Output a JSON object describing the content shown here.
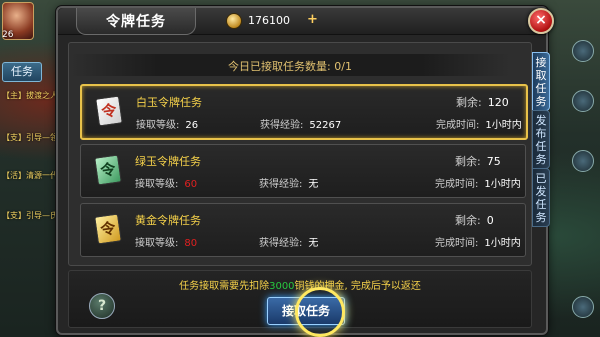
{
  "hud": {
    "level": "26",
    "quest_tab_label": "任务",
    "quest_lines": [
      "【主】拔渡之人",
      "【支】引导—领",
      "【活】清源一代",
      "【支】引导—氏"
    ]
  },
  "panel": {
    "title": "令牌任务",
    "currency_icon": "gold-coin-icon",
    "currency_value": "176100",
    "add_currency_label": "+",
    "close_label": "×"
  },
  "daily": {
    "label": "今日已接取任务数量:",
    "value": "0/1"
  },
  "quests": [
    {
      "name": "白玉令牌任务",
      "token_icon": "white-jade-token-icon",
      "token_char": "令",
      "remaining_label": "剩余:",
      "remaining": "120",
      "level_label": "接取等级:",
      "level": "26",
      "exp_label": "获得经验:",
      "exp": "52267",
      "time_label": "完成时间:",
      "time": "1小时内"
    },
    {
      "name": "绿玉令牌任务",
      "token_icon": "green-jade-token-icon",
      "token_char": "令",
      "remaining_label": "剩余:",
      "remaining": "75",
      "level_label": "接取等级:",
      "level": "60",
      "exp_label": "获得经验:",
      "exp": "无",
      "time_label": "完成时间:",
      "time": "1小时内"
    },
    {
      "name": "黄金令牌任务",
      "token_icon": "gold-token-icon",
      "token_char": "令",
      "remaining_label": "剩余:",
      "remaining": "0",
      "level_label": "接取等级:",
      "level": "80",
      "exp_label": "获得经验:",
      "exp": "无",
      "time_label": "完成时间:",
      "time": "1小时内"
    }
  ],
  "footer": {
    "notice_prefix": "任务接取需要先扣除",
    "notice_amount": "3000",
    "notice_suffix": "铜钱的押金, 完成后予以返还",
    "help_label": "?",
    "accept_label": "接取任务"
  },
  "side_tabs": [
    {
      "label": "接取任务",
      "active": true
    },
    {
      "label": "发布任务",
      "active": false
    },
    {
      "label": "已发任务",
      "active": false
    }
  ],
  "colors": {
    "accent_gold": "#f6d24a",
    "selected_border": "#e8c24a",
    "level_unmet": "#e02020",
    "notice_amount": "#28c840"
  }
}
